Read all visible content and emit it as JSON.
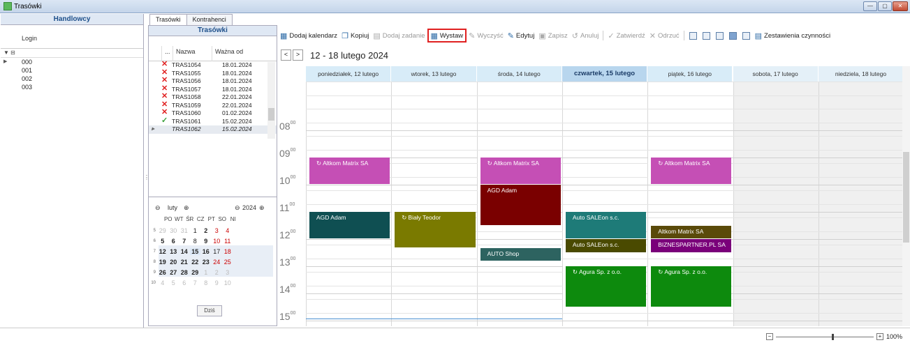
{
  "window": {
    "title": "Trasówki",
    "controls": {
      "minimize": "—",
      "maximize": "▢",
      "close": "✕"
    }
  },
  "left_panel": {
    "header": "Handlowcy",
    "column": "Login",
    "filter_icon": "filter-icon",
    "rows": [
      "000",
      "001",
      "002",
      "003"
    ]
  },
  "tabs": [
    "Trasówki",
    "Kontrahenci"
  ],
  "routes": {
    "header": "Trasówki",
    "columns": {
      "dots": "...",
      "name": "Nazwa",
      "valid_from": "Ważna od"
    },
    "rows": [
      {
        "status": "rejected",
        "name": "TRAS1054",
        "date": "18.01.2024"
      },
      {
        "status": "rejected",
        "name": "TRAS1055",
        "date": "18.01.2024"
      },
      {
        "status": "rejected",
        "name": "TRAS1056",
        "date": "18.01.2024"
      },
      {
        "status": "rejected",
        "name": "TRAS1057",
        "date": "18.01.2024"
      },
      {
        "status": "rejected",
        "name": "TRAS1058",
        "date": "22.01.2024"
      },
      {
        "status": "rejected",
        "name": "TRAS1059",
        "date": "22.01.2024"
      },
      {
        "status": "rejected",
        "name": "TRAS1060",
        "date": "01.02.2024"
      },
      {
        "status": "approved",
        "name": "TRAS1061",
        "date": "15.02.2024"
      },
      {
        "status": "none",
        "name": "TRAS1062",
        "date": "15.02.2024",
        "selected": true
      }
    ]
  },
  "minical": {
    "month": "luty",
    "year": "2024",
    "prev": "⊖",
    "next": "⊕",
    "dow": [
      "PO",
      "WT",
      "ŚR",
      "CZ",
      "PT",
      "SO",
      "NI"
    ],
    "weeks": [
      {
        "n": "5",
        "days": [
          "29",
          "30",
          "31",
          "1",
          "2",
          "3",
          "4"
        ]
      },
      {
        "n": "6",
        "days": [
          "5",
          "6",
          "7",
          "8",
          "9",
          "10",
          "11"
        ]
      },
      {
        "n": "7",
        "days": [
          "12",
          "13",
          "14",
          "15",
          "16",
          "17",
          "18"
        ]
      },
      {
        "n": "8",
        "days": [
          "19",
          "20",
          "21",
          "22",
          "23",
          "24",
          "25"
        ]
      },
      {
        "n": "9",
        "days": [
          "26",
          "27",
          "28",
          "29",
          "1",
          "2",
          "3"
        ]
      },
      {
        "n": "10",
        "days": [
          "4",
          "5",
          "6",
          "7",
          "8",
          "9",
          "10"
        ]
      }
    ],
    "today_button": "Dziś"
  },
  "toolbar": {
    "add_calendar": "Dodaj kalendarz",
    "copy": "Kopiuj",
    "add_task": "Dodaj zadanie",
    "issue": "Wystaw",
    "clear": "Wyczyść",
    "edit": "Edytuj",
    "save": "Zapisz",
    "cancel": "Anuluj",
    "approve": "Zatwierdź",
    "reject": "Odrzuć",
    "summary": "Zestawienia czynności"
  },
  "calendar": {
    "prev": "<",
    "next": ">",
    "range": "12 - 18 lutego 2024",
    "days": [
      {
        "label": "poniedziałek, 12 lutego",
        "type": "normal"
      },
      {
        "label": "wtorek, 13 lutego",
        "type": "normal"
      },
      {
        "label": "środa, 14 lutego",
        "type": "normal"
      },
      {
        "label": "czwartek, 15 lutego",
        "type": "today"
      },
      {
        "label": "piątek, 16 lutego",
        "type": "normal"
      },
      {
        "label": "sobota, 17 lutego",
        "type": "weekend"
      },
      {
        "label": "niedziela, 18 lutego",
        "type": "weekend"
      }
    ],
    "hours": [
      "08",
      "09",
      "10",
      "11",
      "12",
      "13",
      "14",
      "15"
    ],
    "minutes": "00",
    "colors": {
      "magenta": "#c54fb5",
      "darkteal": "#0f4f52",
      "olive": "#7a7a00",
      "maroon": "#7a0000",
      "teal": "#1e7b78",
      "darkolive": "#4a4a00",
      "brown": "#5a4a0a",
      "purple": "#7a007a",
      "slate": "#2d6360",
      "green": "#0d8a0d"
    },
    "events": [
      {
        "day": 0,
        "start": 9.0,
        "end": 10.0,
        "label": "Altkom Matrix SA",
        "color": "magenta",
        "recurring": true
      },
      {
        "day": 0,
        "start": 11.0,
        "end": 12.0,
        "label": "AGD Adam",
        "color": "darkteal",
        "recurring": false
      },
      {
        "day": 1,
        "start": 11.0,
        "end": 12.33,
        "label": "Biały Teodor",
        "color": "olive",
        "recurring": true
      },
      {
        "day": 2,
        "start": 9.0,
        "end": 10.0,
        "label": "Altkom Matrix SA",
        "color": "magenta",
        "recurring": true
      },
      {
        "day": 2,
        "start": 10.0,
        "end": 11.5,
        "label": "AGD Adam",
        "color": "maroon",
        "recurring": false
      },
      {
        "day": 2,
        "start": 12.33,
        "end": 12.83,
        "label": "AUTO Shop",
        "color": "slate",
        "recurring": false
      },
      {
        "day": 3,
        "start": 11.0,
        "end": 12.0,
        "label": "Auto SALEon s.c.",
        "color": "teal",
        "recurring": false
      },
      {
        "day": 3,
        "start": 12.0,
        "end": 12.5,
        "label": "Auto SALEon s.c.",
        "color": "darkolive",
        "recurring": false
      },
      {
        "day": 3,
        "start": 13.0,
        "end": 14.5,
        "label": "Agura Sp. z o.o.",
        "color": "green",
        "recurring": true
      },
      {
        "day": 4,
        "start": 9.0,
        "end": 10.0,
        "label": "Altkom Matrix SA",
        "color": "magenta",
        "recurring": true
      },
      {
        "day": 4,
        "start": 11.5,
        "end": 12.0,
        "label": "Altkom Matrix SA",
        "color": "brown",
        "recurring": false
      },
      {
        "day": 4,
        "start": 12.0,
        "end": 12.5,
        "label": "BIZNESPARTNER.PL SA",
        "color": "purple",
        "recurring": false
      },
      {
        "day": 4,
        "start": 13.0,
        "end": 14.5,
        "label": "Agura Sp. z o.o.",
        "color": "green",
        "recurring": true
      }
    ]
  },
  "status": {
    "zoom": "100%",
    "zoom_out": "−",
    "zoom_in": "+"
  }
}
